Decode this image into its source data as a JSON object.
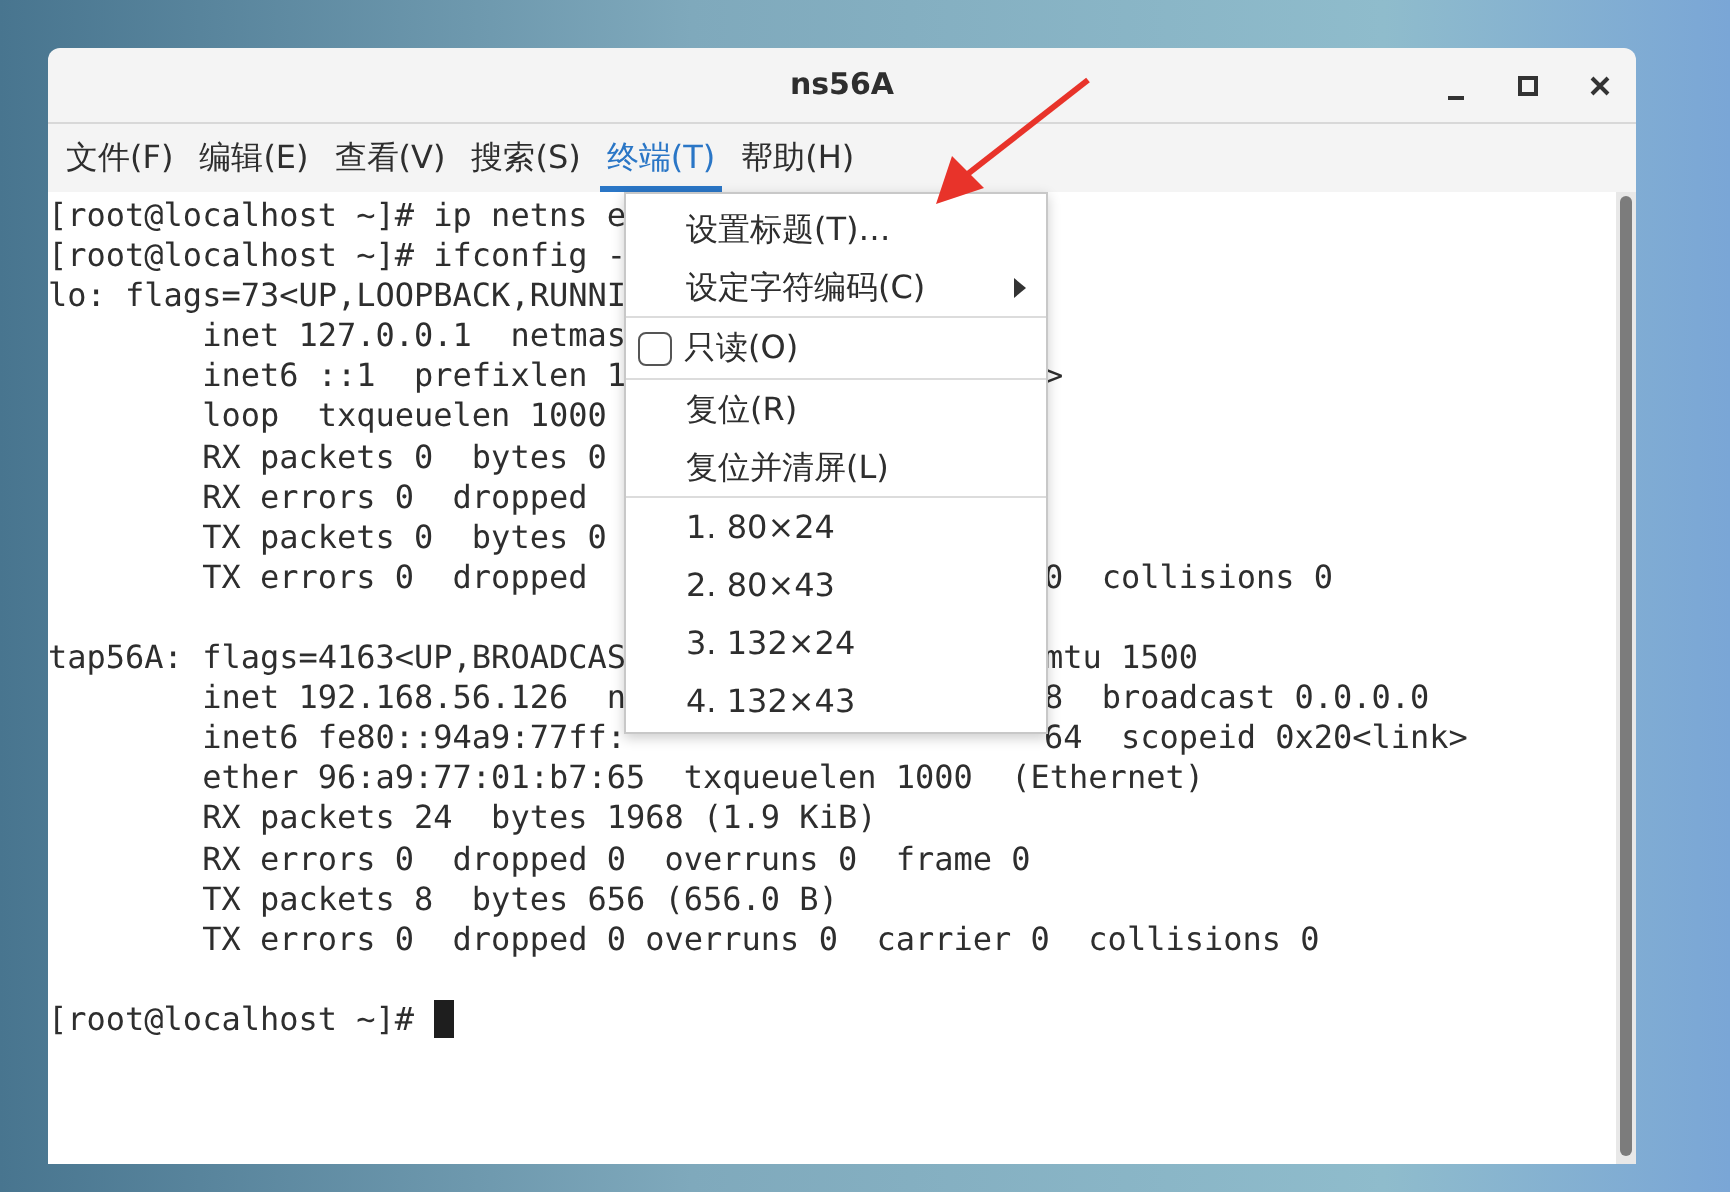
{
  "window": {
    "title": "ns56A"
  },
  "menubar": [
    {
      "label": "文件(F)",
      "selected": false
    },
    {
      "label": "编辑(E)",
      "selected": false
    },
    {
      "label": "查看(V)",
      "selected": false
    },
    {
      "label": "搜索(S)",
      "selected": false
    },
    {
      "label": "终端(T)",
      "selected": true
    },
    {
      "label": "帮助(H)",
      "selected": false
    }
  ],
  "terminal": {
    "blocks": [
      [
        {
          "left": "[root@localhost ~]# ip netns e"
        },
        {
          "left": "[root@localhost ~]# ifconfig -"
        },
        {
          "left": "lo: flags=73<UP,LOOPBACK,RUNNI"
        },
        {
          "left": "        inet 127.0.0.1  netmas"
        },
        {
          "left": "        inet6 ::1  prefixlen 1",
          "right": ">"
        },
        {
          "left": "        loop  txqueuelen 1000"
        },
        {
          "left": "        RX packets 0  bytes 0"
        },
        {
          "left": "        RX errors 0  dropped"
        },
        {
          "left": "        TX packets 0  bytes 0"
        },
        {
          "left": "        TX errors 0  dropped",
          "right": "0  collisions 0"
        }
      ],
      [
        {
          "left": "tap56A: flags=4163<UP,BROADCAS",
          "right": "mtu 1500"
        },
        {
          "left": "        inet 192.168.56.126  n",
          "right": "8  broadcast 0.0.0.0"
        },
        {
          "left": "        inet6 fe80::94a9:77ff:",
          "right": "64  scopeid 0x20<link>"
        },
        {
          "left": "        ether 96:a9:77:01:b7:65  txqueuelen 1000  (Ethernet)"
        },
        {
          "left": "        RX packets 24  bytes 1968 (1.9 KiB)"
        },
        {
          "left": "        RX errors 0  dropped 0  overruns 0  frame 0"
        },
        {
          "left": "        TX packets 8  bytes 656 (656.0 B)"
        },
        {
          "left": "        TX errors 0  dropped 0 overruns 0  carrier 0  collisions 0"
        }
      ],
      [
        {
          "left": "[root@localhost ~]# ",
          "cursor": true
        }
      ]
    ]
  },
  "menu": [
    {
      "kind": "item",
      "label": "设置标题(T)…"
    },
    {
      "kind": "item",
      "label": "设定字符编码(C)",
      "submenu": true
    },
    {
      "kind": "separator"
    },
    {
      "kind": "check",
      "label": "只读(O)",
      "checked": false
    },
    {
      "kind": "separator"
    },
    {
      "kind": "item",
      "label": "复位(R)"
    },
    {
      "kind": "item",
      "label": "复位并清屏(L)"
    },
    {
      "kind": "separator"
    },
    {
      "kind": "item",
      "label": "1. 80×24"
    },
    {
      "kind": "item",
      "label": "2. 80×43"
    },
    {
      "kind": "item",
      "label": "3. 132×24"
    },
    {
      "kind": "item",
      "label": "4. 132×43"
    }
  ]
}
